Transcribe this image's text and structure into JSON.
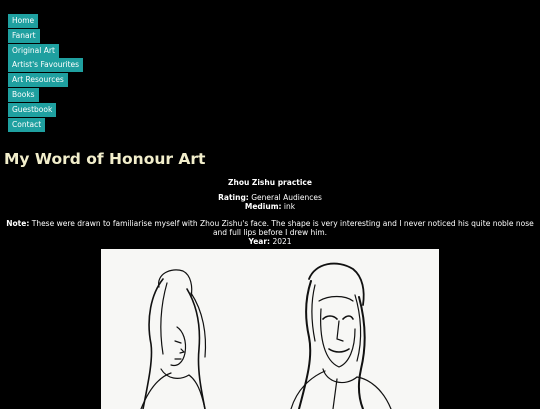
{
  "nav": {
    "items": [
      {
        "label": "Home"
      },
      {
        "label": "Fanart"
      },
      {
        "label": "Original Art"
      },
      {
        "label": "Artist's Favourites"
      },
      {
        "label": "Art Resources"
      },
      {
        "label": "Books"
      },
      {
        "label": "Guestbook"
      },
      {
        "label": "Contact"
      }
    ]
  },
  "site_title": "My Word of Honour Art",
  "artwork": {
    "title": "Zhou Zishu practice",
    "rating_label": "Rating:",
    "rating": "General Audiences",
    "medium_label": "Medium:",
    "medium": "ink",
    "note_label": "Note:",
    "note": "These were drawn to familiarise myself with Zhou Zishu's face. The shape is very interesting and I never noticed his quite noble nose and full lips before I drew him.",
    "year_label": "Year:",
    "year": "2021"
  },
  "colors": {
    "background": "#000000",
    "nav_bg": "#1fa0a0",
    "title": "#f2eecb",
    "text": "#ffffff"
  }
}
